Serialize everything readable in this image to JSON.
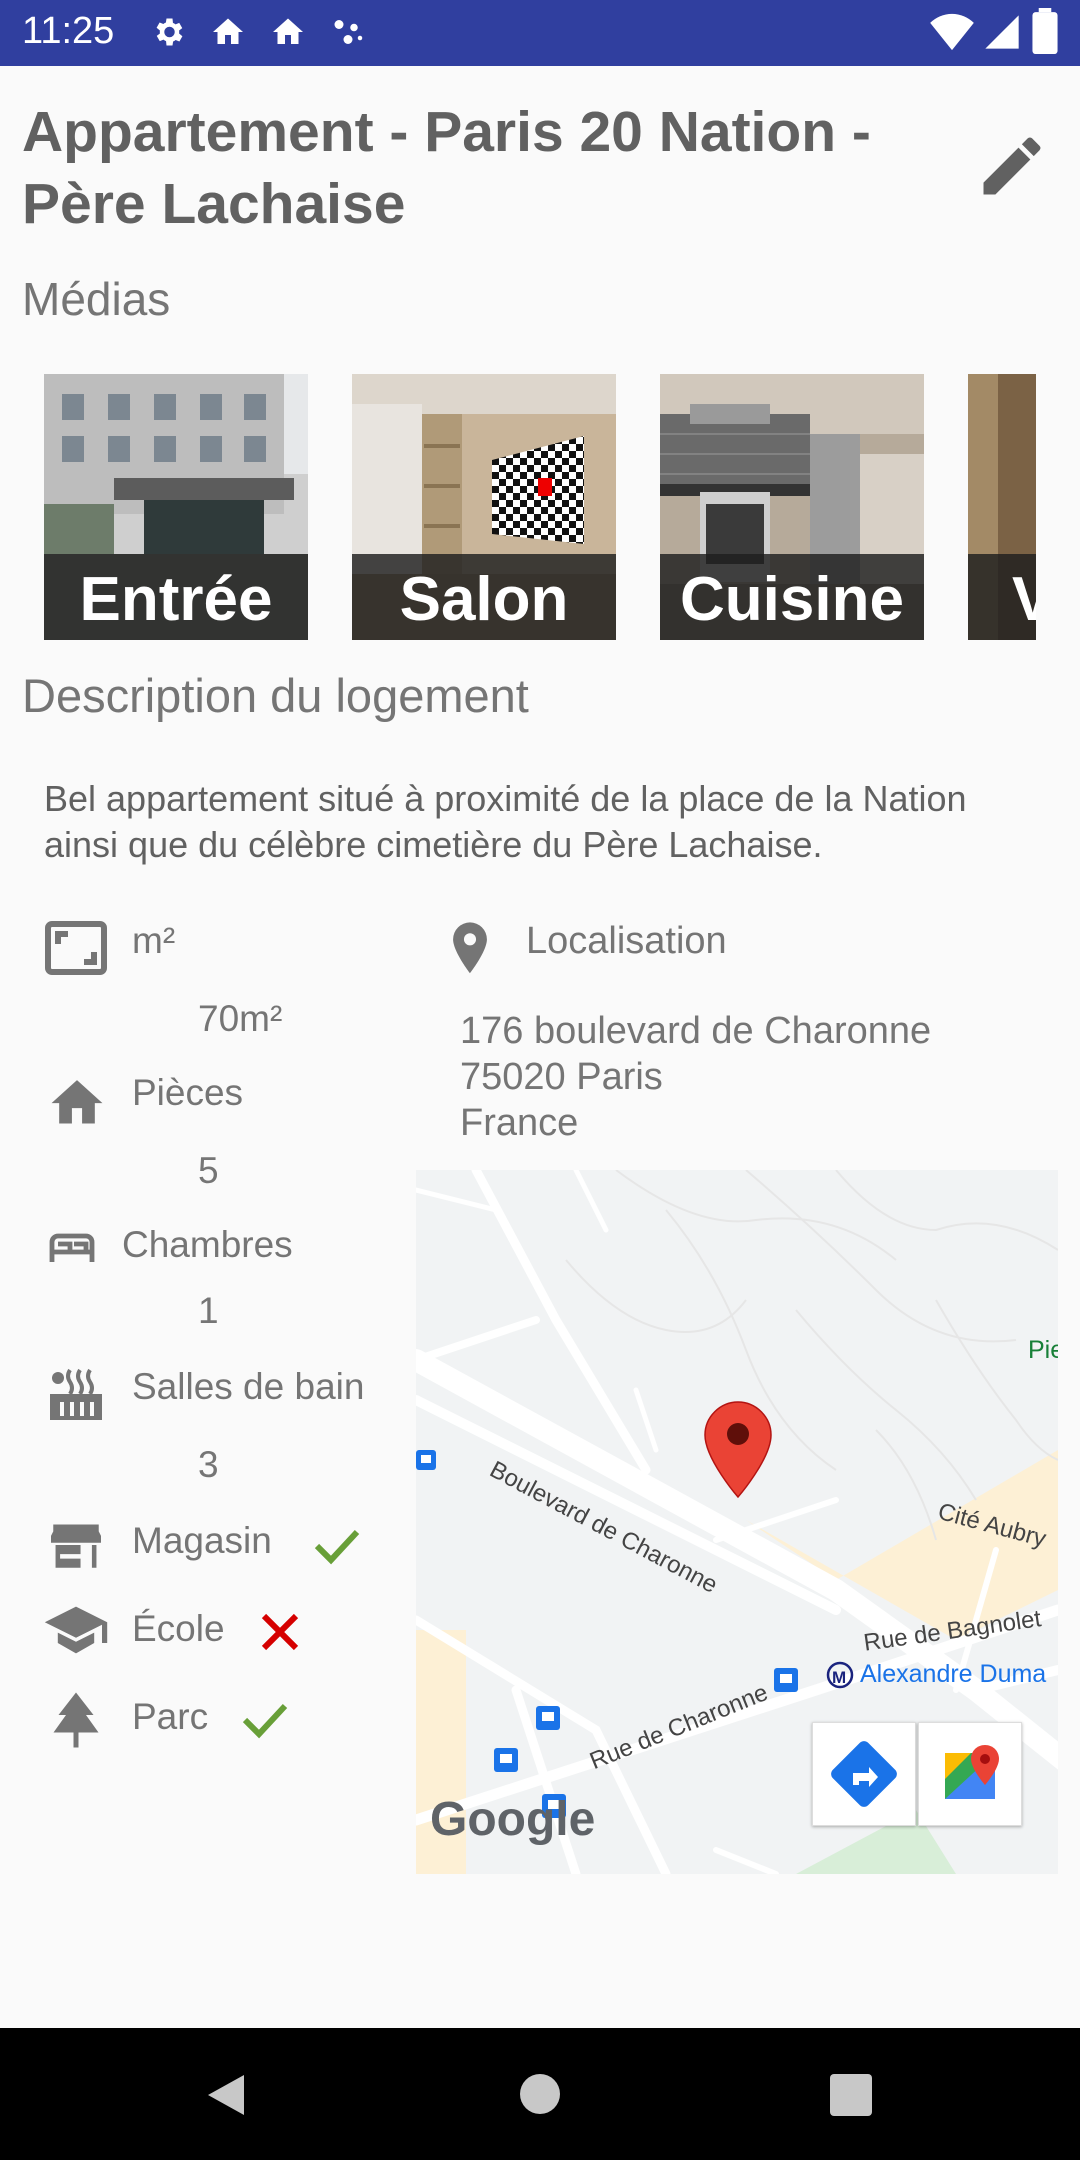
{
  "status_bar": {
    "time": "11:25"
  },
  "listing": {
    "title": "Appartement - Paris 20 Nation - Père Lachaise"
  },
  "media": {
    "section_label": "Médias",
    "items": [
      {
        "caption": "Entrée"
      },
      {
        "caption": "Salon"
      },
      {
        "caption": "Cuisine"
      },
      {
        "caption": "V"
      }
    ]
  },
  "description": {
    "section_label": "Description du logement",
    "text": "Bel appartement situé à proximité de la place de la Nation ainsi que du célèbre cimetière du Père Lachaise."
  },
  "features": {
    "surface": {
      "label": "m²",
      "value": "70m²"
    },
    "rooms": {
      "label": "Pièces",
      "value": "5"
    },
    "bedrooms": {
      "label": "Chambres",
      "value": "1"
    },
    "bathrooms": {
      "label": "Salles de bain",
      "value": "3"
    },
    "shop": {
      "label": "Magasin",
      "available": true
    },
    "school": {
      "label": "École",
      "available": false
    },
    "park": {
      "label": "Parc",
      "available": true
    }
  },
  "location": {
    "label": "Localisation",
    "address_line1": "176 boulevard de Charonne",
    "address_line2": "75020 Paris",
    "address_line3": "France"
  },
  "map": {
    "labels": {
      "boulevard": "Boulevard de Charonne",
      "cite": "Cité Aubry",
      "bagnolet": "Rue de Bagnolet",
      "rue_charonne": "Rue de Charonne",
      "metro": "Alexandre Duma",
      "pie": "Pie",
      "google": "Google"
    }
  },
  "colors": {
    "status_bar": "#303f9f",
    "check": "#689f38",
    "cross": "#d50000",
    "marker": "#ea4335"
  }
}
